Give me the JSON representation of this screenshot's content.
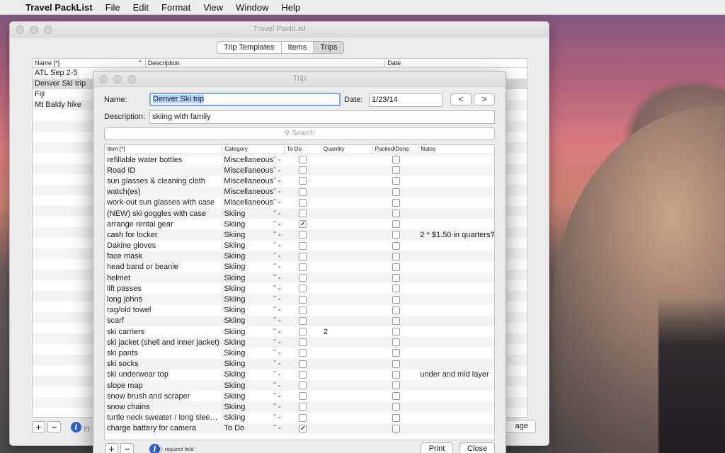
{
  "menubar": {
    "app_name": "Travel PackList",
    "menus": [
      "File",
      "Edit",
      "Format",
      "View",
      "Window",
      "Help"
    ]
  },
  "main_window": {
    "title": "Travel PackList",
    "tabs": [
      "Trip Templates",
      "Items",
      "Trips"
    ],
    "selected_tab": "Trips",
    "list_headers": [
      "Name [*]",
      "Description",
      "Date"
    ],
    "trips": [
      "ATL Sep 2-5",
      "Denver Ski trip",
      "Fiji",
      "Mt Baldy hike"
    ],
    "selected_trip": "Denver Ski trip",
    "required_note": "[*]-",
    "partial_button": "age"
  },
  "trip_window": {
    "title": "Trip",
    "name_label": "Name:",
    "name_value": "Denver Ski trip",
    "date_label": "Date:",
    "date_value": "1/23/14",
    "prev_button": "<",
    "next_button": ">",
    "description_label": "Description:",
    "description_value": "skiing with family",
    "search_placeholder": "Search",
    "columns": [
      "Item [*]",
      "Category",
      "To Do",
      "Quantity",
      "Packed/Done",
      "Notes"
    ],
    "items": [
      {
        "item": "refillable water bottles",
        "category": "Miscellaneous",
        "todo": false,
        "quantity": "",
        "packed": false,
        "notes": ""
      },
      {
        "item": "Road ID",
        "category": "Miscellaneous",
        "todo": false,
        "quantity": "",
        "packed": false,
        "notes": ""
      },
      {
        "item": "sun glasses & cleaning cloth",
        "category": "Miscellaneous",
        "todo": false,
        "quantity": "",
        "packed": false,
        "notes": ""
      },
      {
        "item": "watch(es)",
        "category": "Miscellaneous",
        "todo": false,
        "quantity": "",
        "packed": false,
        "notes": ""
      },
      {
        "item": "work-out sun glasses with case",
        "category": "Miscellaneous",
        "todo": false,
        "quantity": "",
        "packed": false,
        "notes": ""
      },
      {
        "item": "(NEW) ski goggles with case",
        "category": "Skiing",
        "todo": false,
        "quantity": "",
        "packed": false,
        "notes": ""
      },
      {
        "item": "arrange rental gear",
        "category": "Skiing",
        "todo": true,
        "quantity": "",
        "packed": false,
        "notes": ""
      },
      {
        "item": "cash for locker",
        "category": "Skiing",
        "todo": false,
        "quantity": "",
        "packed": false,
        "notes": "2 * $1.50 in quarters?"
      },
      {
        "item": "Dakine gloves",
        "category": "Skiing",
        "todo": false,
        "quantity": "",
        "packed": false,
        "notes": ""
      },
      {
        "item": "face mask",
        "category": "Skiing",
        "todo": false,
        "quantity": "",
        "packed": false,
        "notes": ""
      },
      {
        "item": "head band or beanie",
        "category": "Skiing",
        "todo": false,
        "quantity": "",
        "packed": false,
        "notes": ""
      },
      {
        "item": "helmet",
        "category": "Skiing",
        "todo": false,
        "quantity": "",
        "packed": false,
        "notes": ""
      },
      {
        "item": "lift passes",
        "category": "Skiing",
        "todo": false,
        "quantity": "",
        "packed": false,
        "notes": ""
      },
      {
        "item": "long johns",
        "category": "Skiing",
        "todo": false,
        "quantity": "",
        "packed": false,
        "notes": ""
      },
      {
        "item": "rag/old towel",
        "category": "Skiing",
        "todo": false,
        "quantity": "",
        "packed": false,
        "notes": ""
      },
      {
        "item": "scarf",
        "category": "Skiing",
        "todo": false,
        "quantity": "",
        "packed": false,
        "notes": ""
      },
      {
        "item": "ski carriers",
        "category": "Skiing",
        "todo": false,
        "quantity": "2",
        "packed": false,
        "notes": ""
      },
      {
        "item": "ski jacket (shell and inner jacket)",
        "category": "Skiing",
        "todo": false,
        "quantity": "",
        "packed": false,
        "notes": ""
      },
      {
        "item": "ski pants",
        "category": "Skiing",
        "todo": false,
        "quantity": "",
        "packed": false,
        "notes": ""
      },
      {
        "item": "ski socks",
        "category": "Skiing",
        "todo": false,
        "quantity": "",
        "packed": false,
        "notes": ""
      },
      {
        "item": "ski underwear top",
        "category": "Skiing",
        "todo": false,
        "quantity": "",
        "packed": false,
        "notes": "under and mid layer"
      },
      {
        "item": "slope map",
        "category": "Skiing",
        "todo": false,
        "quantity": "",
        "packed": false,
        "notes": ""
      },
      {
        "item": "snow brush and scraper",
        "category": "Skiing",
        "todo": false,
        "quantity": "",
        "packed": false,
        "notes": ""
      },
      {
        "item": "snow chains",
        "category": "Skiing",
        "todo": false,
        "quantity": "",
        "packed": false,
        "notes": ""
      },
      {
        "item": "turtle neck sweater / long slee…",
        "category": "Skiing",
        "todo": false,
        "quantity": "",
        "packed": false,
        "notes": ""
      },
      {
        "item": "charge battery for camera",
        "category": "To Do",
        "todo": true,
        "quantity": "",
        "packed": false,
        "notes": ""
      }
    ],
    "add_button": "+",
    "remove_button": "−",
    "required_note": "[*]- required field",
    "print_button": "Print",
    "close_button": "Close"
  }
}
